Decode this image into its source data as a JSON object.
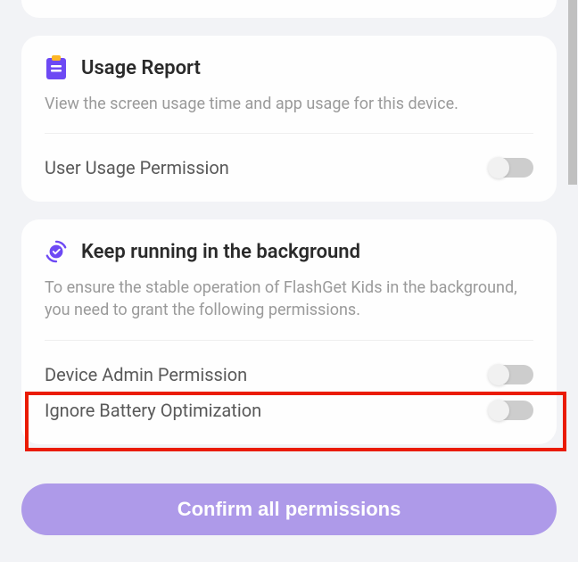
{
  "cards": [
    {
      "title": "Usage Report",
      "description": "View the screen usage time and app usage for this device.",
      "permissions": [
        {
          "label": "User Usage Permission",
          "enabled": false
        }
      ]
    },
    {
      "title": "Keep running in the background",
      "description": "To ensure the stable operation of FlashGet Kids in the background, you need to grant the following permissions.",
      "permissions": [
        {
          "label": "Device Admin Permission",
          "enabled": false
        },
        {
          "label": "Ignore Battery Optimization",
          "enabled": false
        }
      ]
    }
  ],
  "confirm_label": "Confirm all permissions"
}
